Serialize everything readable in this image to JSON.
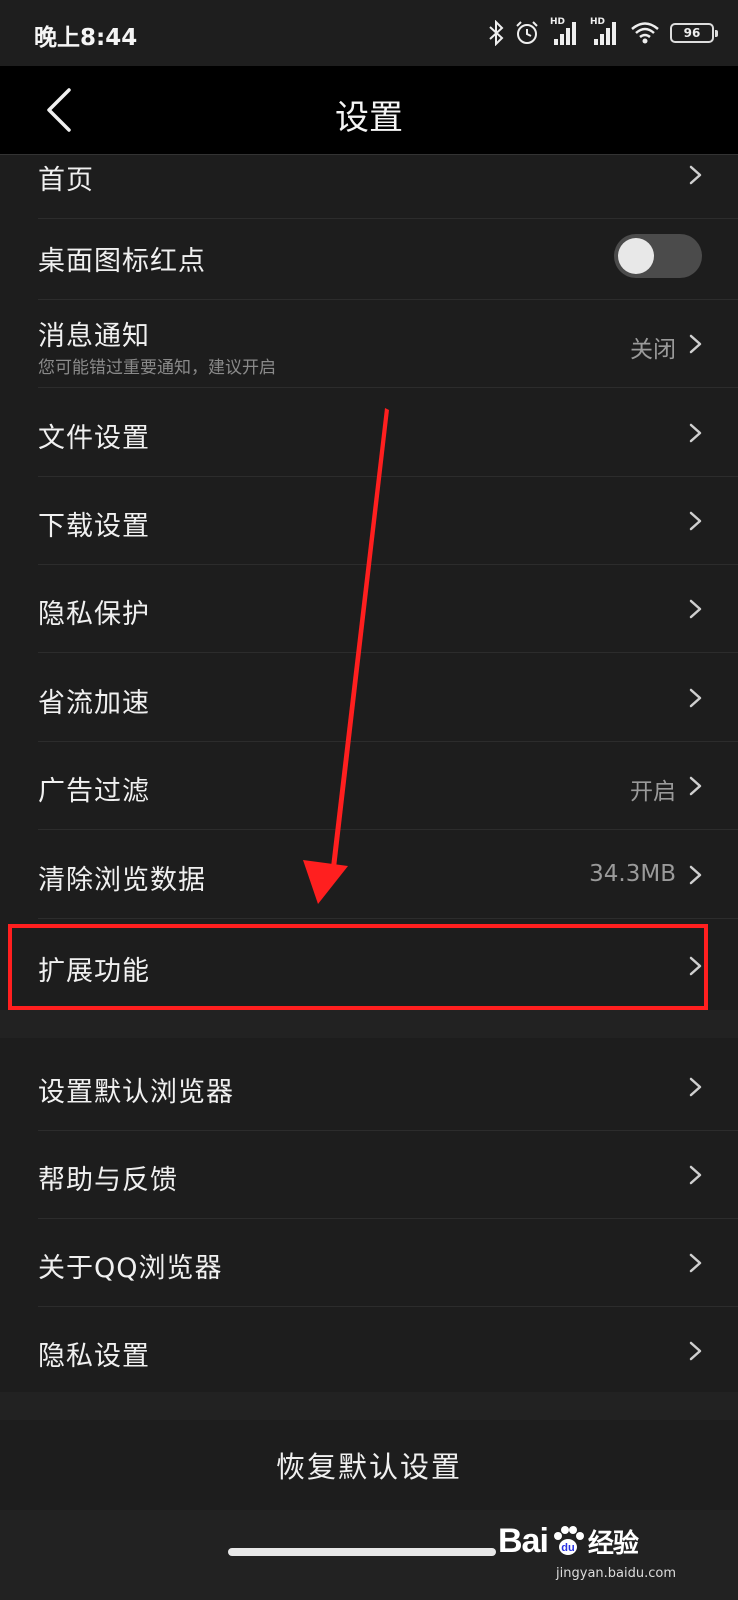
{
  "status_bar": {
    "time": "晚上8:44",
    "hd_label": "HD",
    "battery_level": "96"
  },
  "nav": {
    "title": "设置"
  },
  "group1": {
    "items": [
      {
        "label": "首页"
      },
      {
        "label": "桌面图标红点",
        "toggle": false
      },
      {
        "label": "消息通知",
        "subtitle": "您可能错过重要通知，建议开启",
        "value": "关闭"
      },
      {
        "label": "文件设置"
      },
      {
        "label": "下载设置"
      },
      {
        "label": "隐私保护"
      },
      {
        "label": "省流加速"
      },
      {
        "label": "广告过滤",
        "value": "开启"
      },
      {
        "label": "清除浏览数据",
        "value": "34.3MB"
      },
      {
        "label": "扩展功能"
      }
    ]
  },
  "group2": {
    "items": [
      {
        "label": "设置默认浏览器"
      },
      {
        "label": "帮助与反馈"
      },
      {
        "label": "关于QQ浏览器"
      },
      {
        "label": "隐私设置"
      }
    ]
  },
  "reset_button": "恢复默认设置",
  "watermark": {
    "brand": "Bai",
    "brand_suffix": "经验",
    "url": "jingyan.baidu.com"
  },
  "colors": {
    "background": "#1b1b1b",
    "nav_background": "#000000",
    "annotation": "#ff1f1f",
    "toggle_off": "#4b4b4b"
  }
}
